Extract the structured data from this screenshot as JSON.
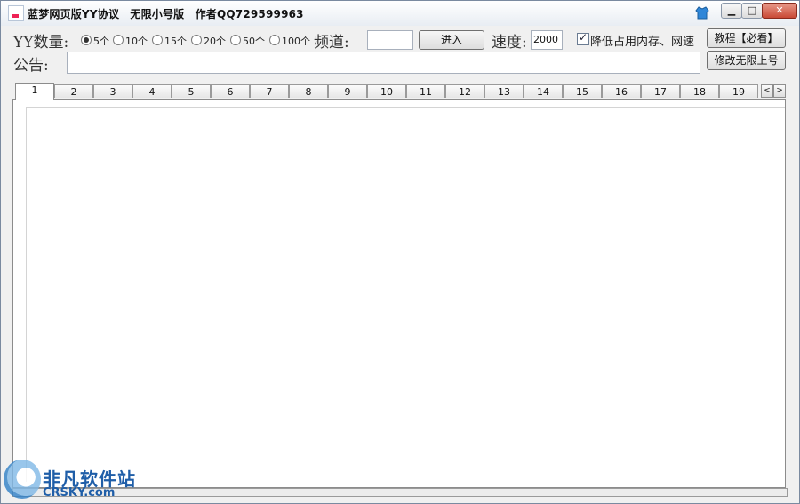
{
  "window": {
    "title": "蓝梦网页版YY协议　无限小号版　作者QQ729599963",
    "min_glyph": "▁",
    "max_glyph": "□",
    "close_glyph": "✕"
  },
  "toolbar": {
    "yy_count_label": "YY数量:",
    "count_options": [
      "5个",
      "10个",
      "15个",
      "20个",
      "50个",
      "100个"
    ],
    "selected_count": "5个",
    "channel_label": "频道:",
    "channel_value": "",
    "enter_button": "进入",
    "speed_label": "速度:",
    "speed_value": "2000",
    "low_memory_label": "降低占用内存、网速",
    "low_memory_checked": true,
    "tutorial_button": "教程【必看】",
    "unlimited_button": "修改无限上号",
    "notice_label": "公告:",
    "notice_value": ""
  },
  "tabs": [
    "1",
    "2",
    "3",
    "4",
    "5",
    "6",
    "7",
    "8",
    "9",
    "10",
    "11",
    "12",
    "13",
    "14",
    "15",
    "16",
    "17",
    "18",
    "19"
  ],
  "active_tab": "1",
  "scroll": {
    "left": "<",
    "right": ">"
  },
  "watermark": {
    "cn": "非凡软件站",
    "en": "CRSKY.com"
  },
  "colors": {
    "frame_border": "#7a8aa0",
    "title_close": "#c94a35",
    "brand_blue": "#1f5ea8"
  }
}
